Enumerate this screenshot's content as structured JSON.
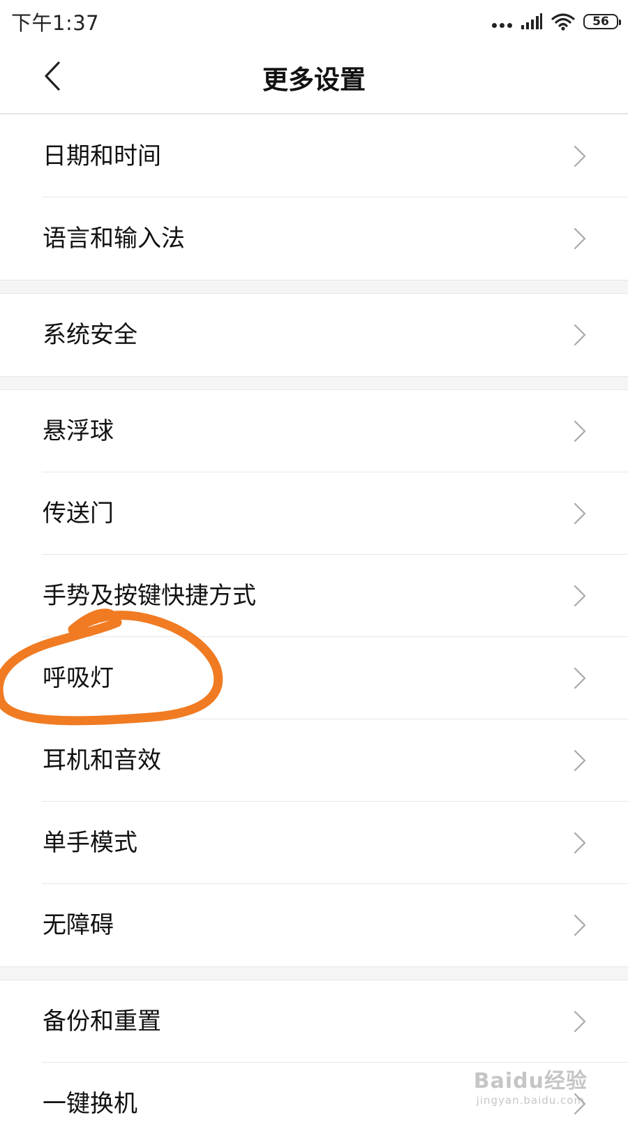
{
  "status_bar": {
    "time": "下午1:37",
    "battery": "56"
  },
  "header": {
    "title": "更多设置"
  },
  "groups": [
    {
      "items": [
        {
          "label": "日期和时间"
        },
        {
          "label": "语言和输入法"
        }
      ]
    },
    {
      "items": [
        {
          "label": "系统安全"
        }
      ]
    },
    {
      "items": [
        {
          "label": "悬浮球"
        },
        {
          "label": "传送门"
        },
        {
          "label": "手势及按键快捷方式"
        },
        {
          "label": "呼吸灯"
        },
        {
          "label": "耳机和音效"
        },
        {
          "label": "单手模式"
        },
        {
          "label": "无障碍"
        }
      ]
    },
    {
      "items": [
        {
          "label": "备份和重置"
        },
        {
          "label": "一键换机"
        }
      ]
    }
  ],
  "watermark": {
    "logo": "Baidu经验",
    "url": "jingyan.baidu.com"
  },
  "colors": {
    "annotation": "#f07b22",
    "divider": "#e6e6e6",
    "group_gap": "#f5f5f5"
  }
}
